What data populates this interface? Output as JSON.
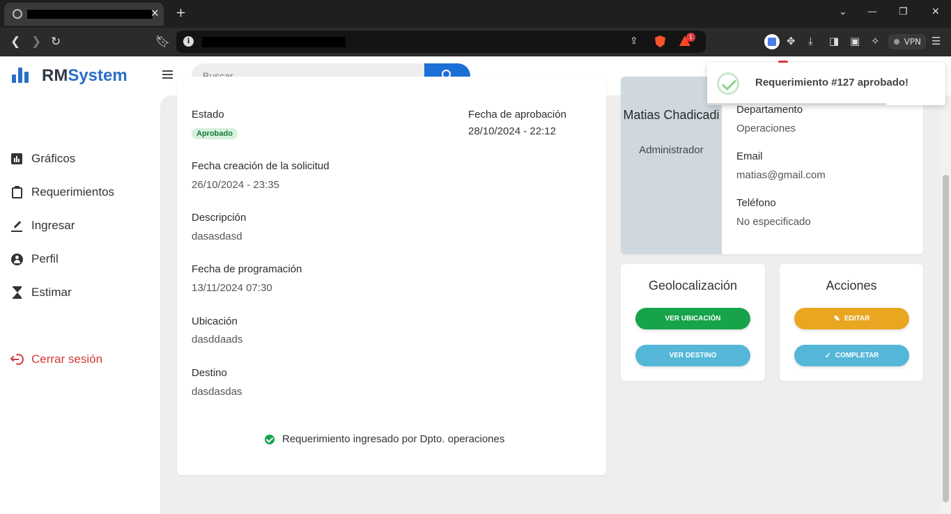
{
  "browser": {
    "tab_close": "✕",
    "new_tab": "+",
    "notification_count": "1",
    "vpn_label": "VPN"
  },
  "app": {
    "brand_prefix": "RM",
    "brand_suffix": "System",
    "brand_color": "#2a6fc7",
    "search": {
      "placeholder": "Buscar..."
    }
  },
  "sidebar": {
    "items": [
      {
        "label": "Gráficos",
        "icon": "chart-icon"
      },
      {
        "label": "Requerimientos",
        "icon": "clipboard-icon"
      },
      {
        "label": "Ingresar",
        "icon": "pencil-icon"
      },
      {
        "label": "Perfil",
        "icon": "user-icon"
      },
      {
        "label": "Estimar",
        "icon": "hourglass-icon"
      }
    ],
    "logout": {
      "label": "Cerrar sesión",
      "icon": "logout-icon",
      "color": "#d23a3a"
    }
  },
  "request": {
    "status_label": "Estado",
    "status_value": "Aprobado",
    "approval_date_label": "Fecha de aprobación",
    "approval_date_value": "28/10/2024 - 22:12",
    "created_label": "Fecha creación de la solicitud",
    "created_value": "26/10/2024 - 23:35",
    "description_label": "Descripción",
    "description_value": "dasasdasd",
    "scheduled_label": "Fecha de programación",
    "scheduled_value": "13/11/2024 07:30",
    "location_label": "Ubicación",
    "location_value": "dasddaads",
    "destination_label": "Destino",
    "destination_value": "dasdasdas",
    "footer_note": "Requerimiento ingresado por Dpto. operaciones"
  },
  "profile": {
    "name": "Matias Chadicadi",
    "role": "Administrador",
    "department_label": "Departamento",
    "department_value": "Operaciones",
    "email_label": "Email",
    "email_value": "matias@gmail.com",
    "phone_label": "Teléfono",
    "phone_value": "No especificado"
  },
  "geolocation": {
    "title": "Geolocalización",
    "view_location": "VER UBICACIÓN",
    "view_destination": "VER DESTINO"
  },
  "actions": {
    "title": "Acciones",
    "edit": "EDITAR",
    "complete": "COMPLETAR"
  },
  "toast": {
    "message": "Requerimiento #127 aprobado!",
    "progress_fraction": 0.75
  }
}
